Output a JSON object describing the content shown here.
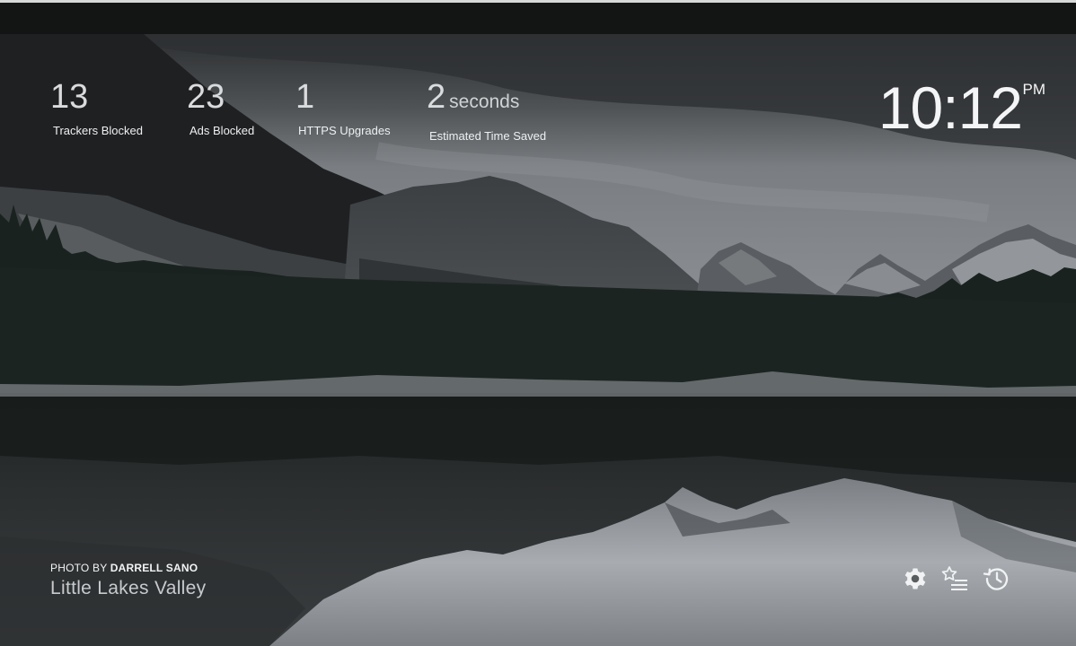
{
  "stats": [
    {
      "value": "13",
      "unit": "",
      "label": "Trackers Blocked"
    },
    {
      "value": "23",
      "unit": "",
      "label": "Ads Blocked"
    },
    {
      "value": "1",
      "unit": "",
      "label": "HTTPS Upgrades"
    },
    {
      "value": "2",
      "unit": "seconds",
      "label": "Estimated Time Saved"
    }
  ],
  "clock": {
    "time": "10:12",
    "ampm": "PM"
  },
  "credit": {
    "prefix": "PHOTO BY",
    "photographer": "DARRELL SANO",
    "location": "Little Lakes Valley"
  },
  "toolbar": {
    "settings_icon": "gear-icon",
    "bookmarks_icon": "bookmarks-icon",
    "history_icon": "history-icon"
  },
  "colors": {
    "text": "#f4f5f6",
    "stat_number": "#d9dbdd",
    "background": "#141617"
  }
}
